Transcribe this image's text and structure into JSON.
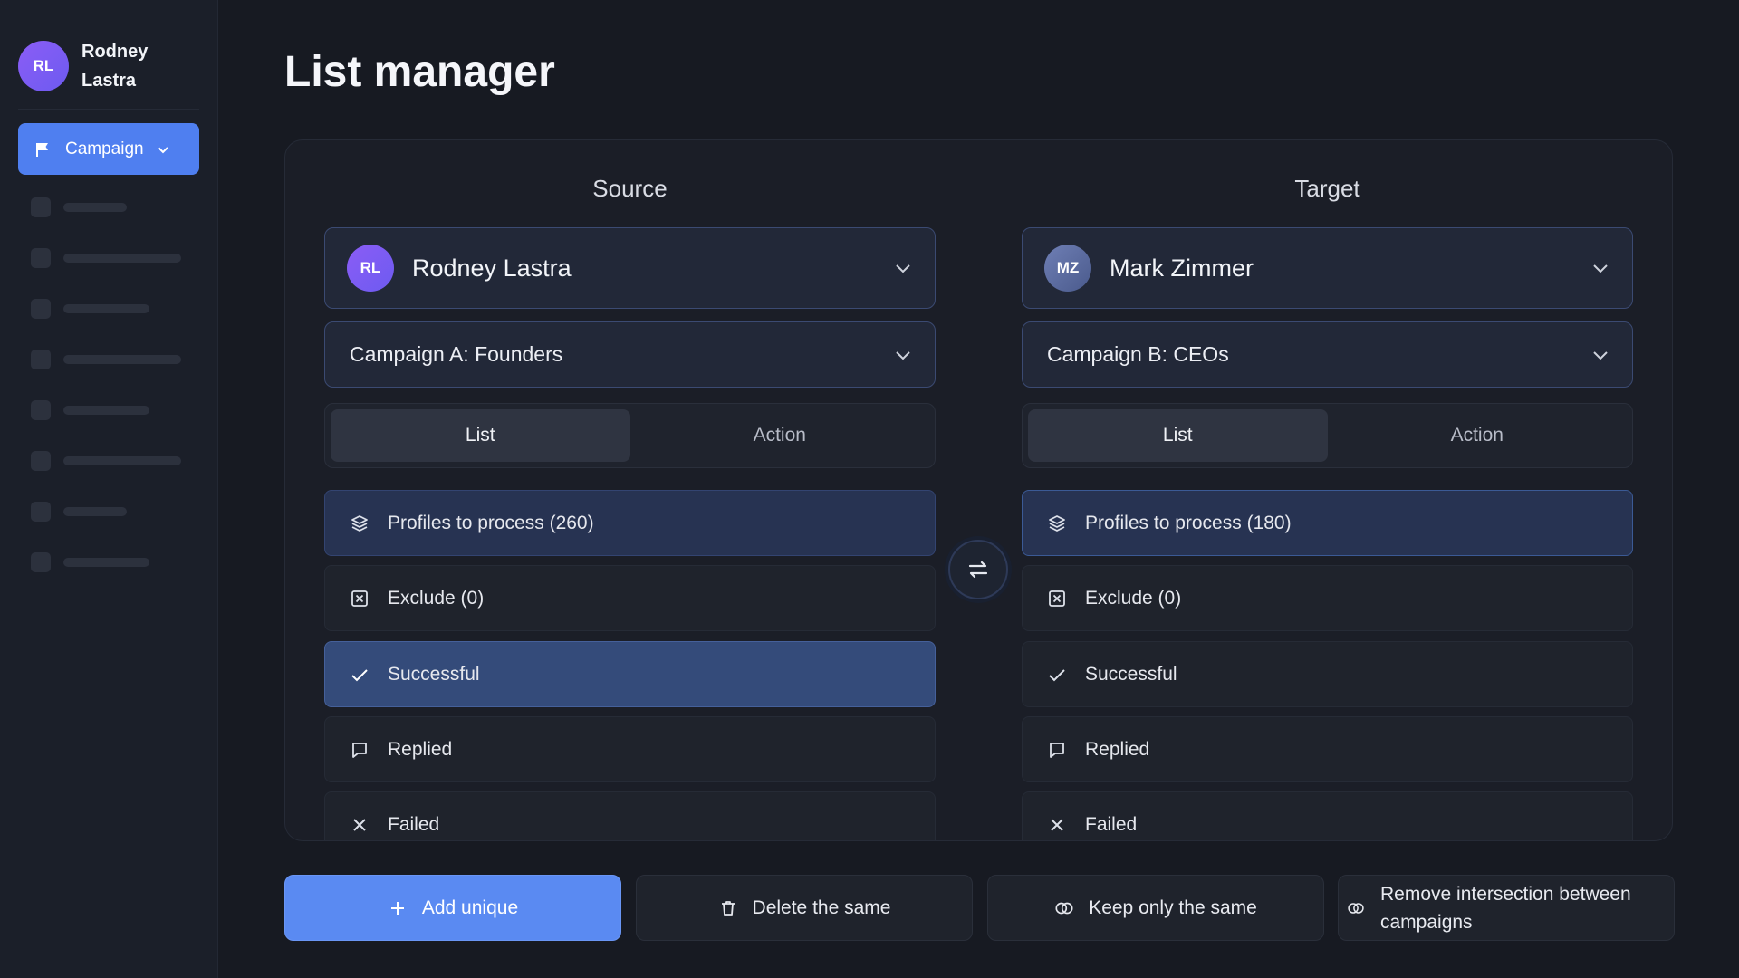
{
  "sidebar": {
    "user": {
      "initials": "RL",
      "name": "Rodney Lastra"
    },
    "campaign_button": {
      "label": "Campaign",
      "icon": "flag-icon"
    }
  },
  "page": {
    "title": "List manager"
  },
  "source": {
    "heading": "Source",
    "person": {
      "initials": "RL",
      "name": "Rodney Lastra"
    },
    "campaign": "Campaign A: Founders",
    "tabs": {
      "list": "List",
      "action": "Action",
      "active": "List"
    },
    "rows": [
      {
        "label": "Profiles to process (260)",
        "icon": "layers-icon"
      },
      {
        "label": "Exclude (0)",
        "icon": "exclude-icon"
      },
      {
        "label": "Successful",
        "icon": "check-icon"
      },
      {
        "label": "Replied",
        "icon": "message-icon"
      },
      {
        "label": "Failed",
        "icon": "x-icon"
      }
    ]
  },
  "target": {
    "heading": "Target",
    "person": {
      "initials": "MZ",
      "name": "Mark Zimmer"
    },
    "campaign": "Campaign B: CEOs",
    "tabs": {
      "list": "List",
      "action": "Action",
      "active": "List"
    },
    "rows": [
      {
        "label": "Profiles to process (180)",
        "icon": "layers-icon"
      },
      {
        "label": "Exclude (0)",
        "icon": "exclude-icon"
      },
      {
        "label": "Successful",
        "icon": "check-icon"
      },
      {
        "label": "Replied",
        "icon": "message-icon"
      },
      {
        "label": "Failed",
        "icon": "x-icon"
      }
    ]
  },
  "actions": {
    "add_unique": "Add unique",
    "delete_same": "Delete the same",
    "keep_same": "Keep only the same",
    "remove_intersection": "Remove intersection between campaigns"
  },
  "colors": {
    "accent": "#5a8af2",
    "background": "#171a22",
    "highlight": "#344b7a"
  }
}
